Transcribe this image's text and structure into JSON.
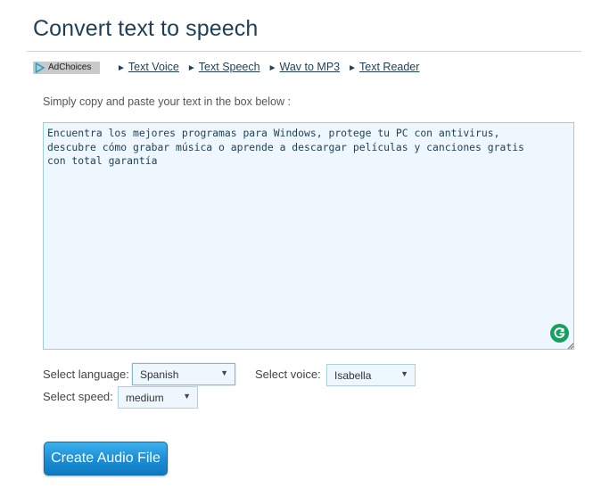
{
  "page": {
    "title": "Convert text to speech"
  },
  "ad": {
    "label": "AdChoices"
  },
  "nav": {
    "links": [
      {
        "label": "Text Voice"
      },
      {
        "label": "Text Speech"
      },
      {
        "label": "Wav to MP3"
      },
      {
        "label": "Text Reader"
      }
    ],
    "arrow": "►"
  },
  "form": {
    "instruction": "Simply copy and paste your text in the box below :",
    "text_value": "Encuentra los mejores programas para Windows, protege tu PC con antivirus,\ndescubre cómo grabar música o aprende a descargar películas y canciones gratis\ncon total garantía",
    "language": {
      "label": "Select language:",
      "selected": "Spanish"
    },
    "voice": {
      "label": "Select voice:",
      "selected": "Isabella"
    },
    "speed": {
      "label": "Select speed:",
      "selected": "medium"
    },
    "caret": "▼",
    "submit_label": "Create Audio File"
  },
  "colors": {
    "title": "#1f3f57",
    "textbox_bg": "#eef7fd",
    "button": "#1c8fd6",
    "grammarly": "#15a05f"
  }
}
